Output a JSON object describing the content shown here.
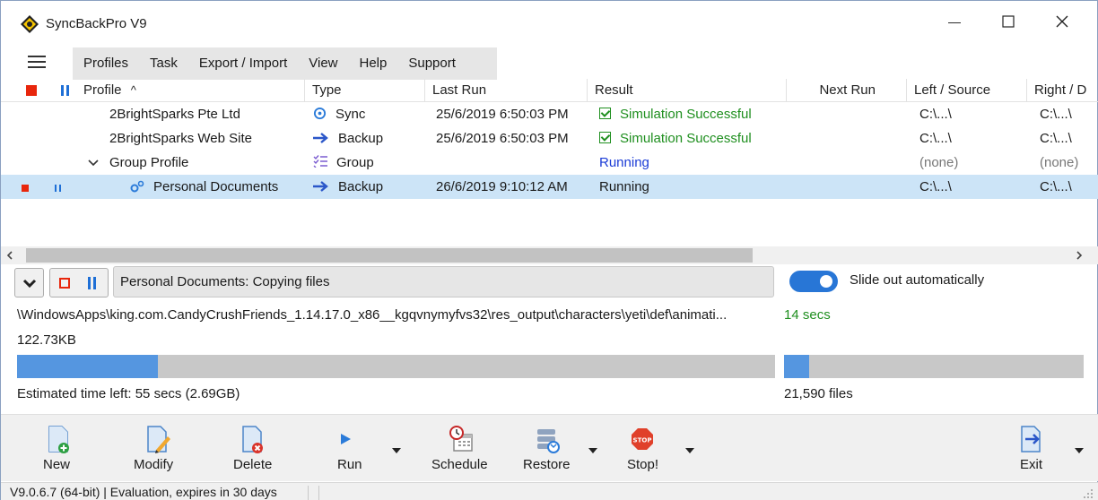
{
  "window": {
    "title": "SyncBackPro V9",
    "minimize_glyph": "—",
    "maximize_glyph": "☐",
    "close_glyph": "✕"
  },
  "menu": {
    "items": [
      "Profiles",
      "Task",
      "Export / Import",
      "View",
      "Help",
      "Support"
    ]
  },
  "table": {
    "columns": {
      "profile": "Profile",
      "type": "Type",
      "last_run": "Last Run",
      "result": "Result",
      "next_run": "Next Run",
      "left_source": "Left / Source",
      "right_dest": "Right / D"
    },
    "sort_indicator": "^",
    "rows": [
      {
        "profile": "2BrightSparks Pte Ltd",
        "type": "Sync",
        "type_icon": "sync-icon",
        "last_run": "25/6/2019 6:50:03 PM",
        "result": "Simulation Successful",
        "next_run": "",
        "left": "C:\\...\\",
        "right": "C:\\...\\"
      },
      {
        "profile": "2BrightSparks Web Site",
        "type": "Backup",
        "type_icon": "arrow-right-icon",
        "last_run": "25/6/2019 6:50:03 PM",
        "result": "Simulation Successful",
        "next_run": "",
        "left": "C:\\...\\",
        "right": "C:\\...\\"
      },
      {
        "profile": "Group Profile",
        "type": "Group",
        "type_icon": "checklist-icon",
        "last_run": "",
        "result": "Running",
        "next_run": "",
        "left": "(none)",
        "right": "(none)"
      },
      {
        "profile": "Personal Documents",
        "type": "Backup",
        "type_icon": "arrow-right-icon",
        "last_run": "26/6/2019 9:10:12 AM",
        "result": "Running",
        "next_run": "",
        "left": "C:\\...\\",
        "right": "C:\\...\\"
      }
    ],
    "colors": {
      "success": "#1f8f1f",
      "running_link": "#1a3bd6",
      "selected_row": "#cce4f7",
      "stop_red": "#e8260c",
      "pause_blue": "#1e6fd6"
    }
  },
  "progress": {
    "status_text": "Personal Documents: Copying files",
    "slide_out_label": "Slide out automatically",
    "slide_out_enabled": true,
    "current_path": "\\WindowsApps\\king.com.CandyCrushFriends_1.14.17.0_x86__kgqvnymyfvs32\\res_output\\characters\\yeti\\def\\animati...",
    "elapsed": "14 secs",
    "file_size": "122.73KB",
    "main_progress_fraction": 0.186,
    "files_progress_fraction": 0.085,
    "estimated_time": "Estimated time left: 55 secs (2.69GB)",
    "files_count": "21,590 files"
  },
  "toolbar": {
    "new_label": "New",
    "modify_label": "Modify",
    "delete_label": "Delete",
    "run_label": "Run",
    "schedule_label": "Schedule",
    "restore_label": "Restore",
    "stop_label": "Stop!",
    "stop_sign_text": "STOP",
    "exit_label": "Exit"
  },
  "statusbar": {
    "text": "V9.0.6.7 (64-bit) | Evaluation, expires in 30 days"
  }
}
